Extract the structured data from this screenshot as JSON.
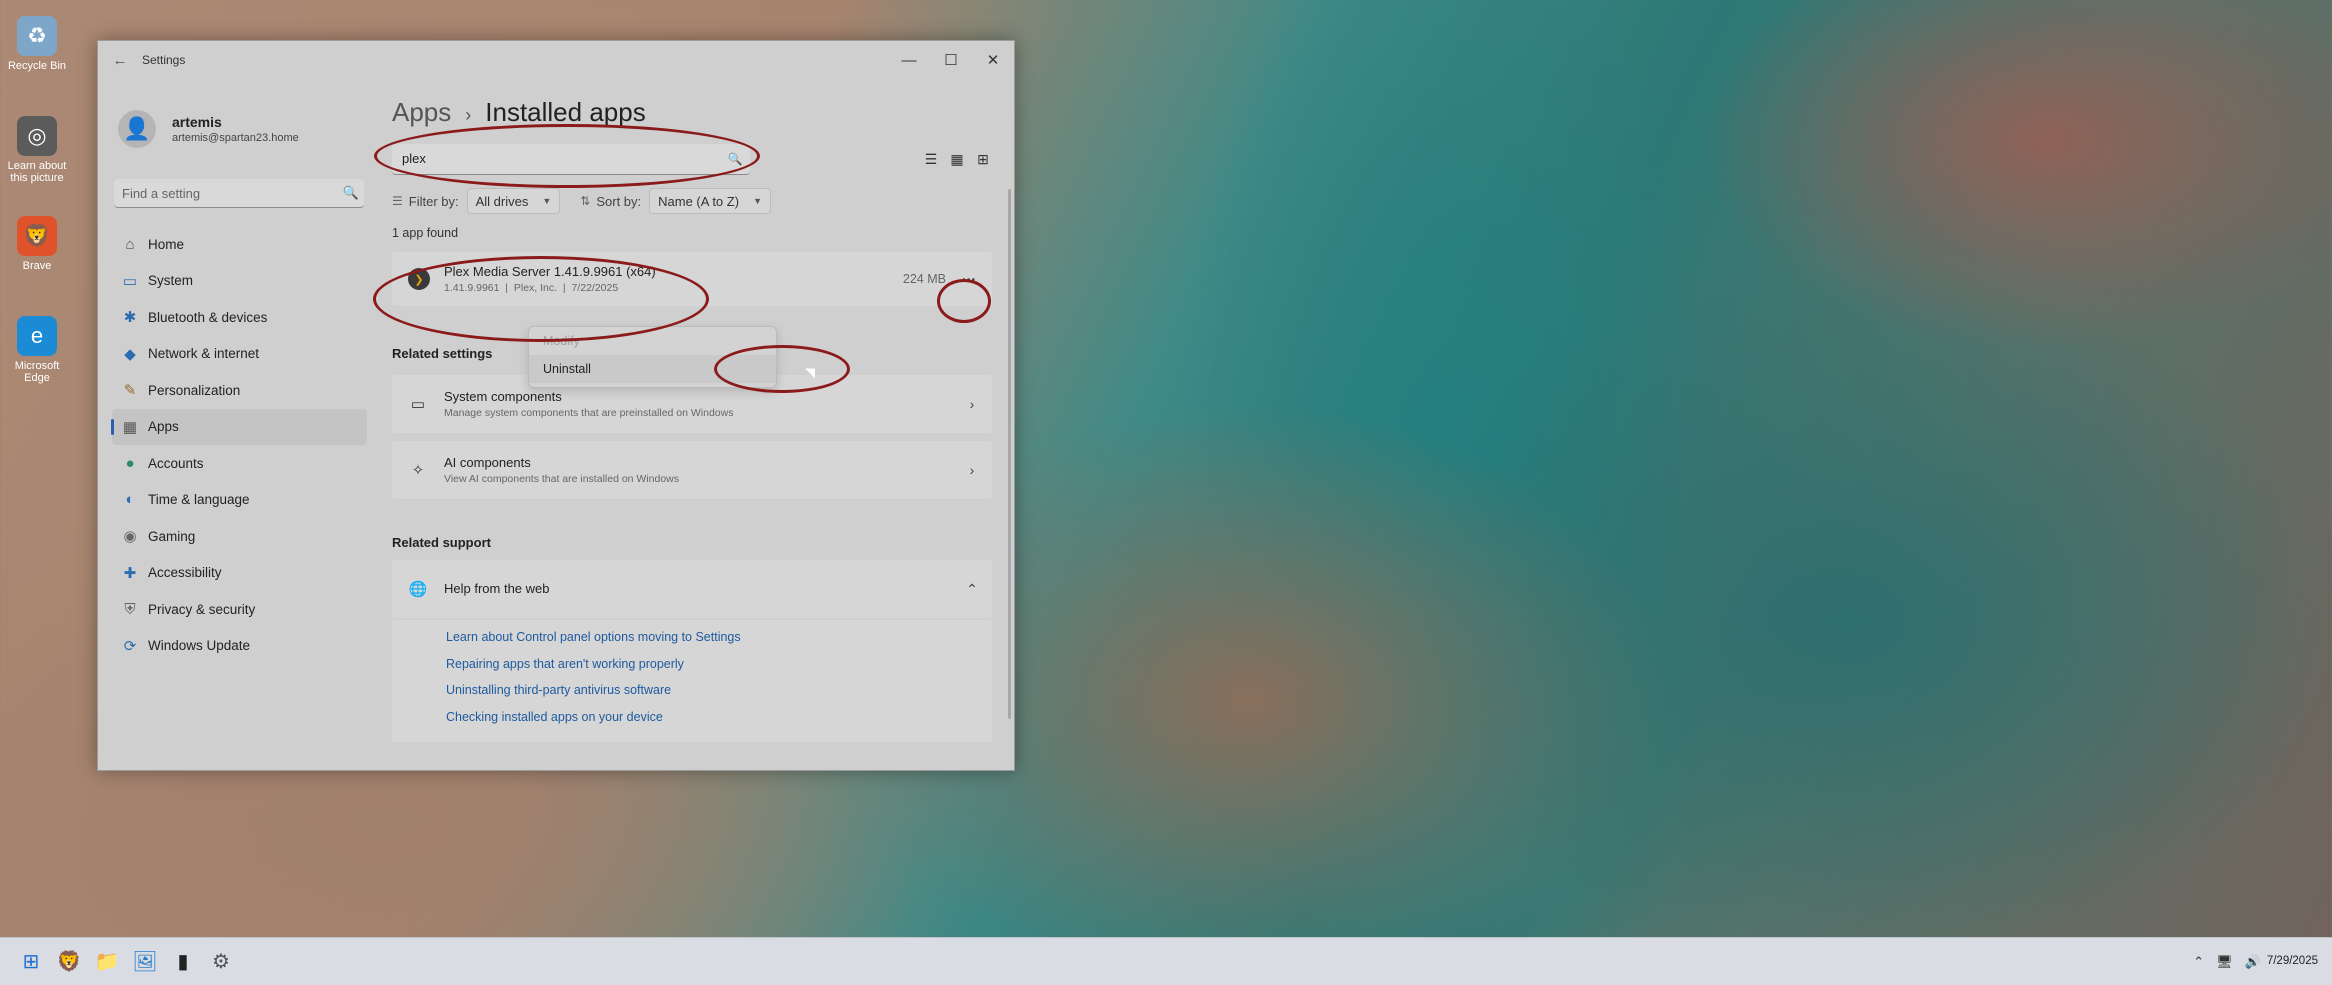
{
  "desktop": {
    "icons": [
      {
        "name": "recycle-bin-icon",
        "label": "Recycle Bin",
        "glyph": "♻",
        "color": "#7da6c9"
      },
      {
        "name": "learn-about-picture-icon",
        "label": "Learn about this picture",
        "glyph": "◎",
        "color": "#5b5b5b"
      },
      {
        "name": "brave-icon",
        "label": "Brave",
        "glyph": "🦁",
        "color": "#e0522a"
      },
      {
        "name": "edge-icon",
        "label": "Microsoft Edge",
        "glyph": "e",
        "color": "#1a8bd4"
      }
    ]
  },
  "window": {
    "title": "Settings",
    "back_glyph": "←",
    "minimize_glyph": "—",
    "maximize_glyph": "☐",
    "close_glyph": "✕"
  },
  "user": {
    "name": "artemis",
    "email": "artemis@spartan23.home"
  },
  "find_setting": {
    "placeholder": "Find a setting",
    "icon": "🔍"
  },
  "nav": [
    {
      "key": "home",
      "label": "Home",
      "icon": "⌂",
      "color": "#555"
    },
    {
      "key": "system",
      "label": "System",
      "icon": "▭",
      "color": "#2b6cb0"
    },
    {
      "key": "bluetooth",
      "label": "Bluetooth & devices",
      "icon": "✱",
      "color": "#2b6cb0"
    },
    {
      "key": "network",
      "label": "Network & internet",
      "icon": "◆",
      "color": "#2b6cb0"
    },
    {
      "key": "personalization",
      "label": "Personalization",
      "icon": "✎",
      "color": "#9b6a2f"
    },
    {
      "key": "apps",
      "label": "Apps",
      "icon": "▦",
      "color": "#555",
      "active": true
    },
    {
      "key": "accounts",
      "label": "Accounts",
      "icon": "●",
      "color": "#2a8a6a"
    },
    {
      "key": "time",
      "label": "Time & language",
      "icon": "◐",
      "color": "#2b6cb0"
    },
    {
      "key": "gaming",
      "label": "Gaming",
      "icon": "◉",
      "color": "#666"
    },
    {
      "key": "accessibility",
      "label": "Accessibility",
      "icon": "✚",
      "color": "#2b6cb0"
    },
    {
      "key": "privacy",
      "label": "Privacy & security",
      "icon": "⛨",
      "color": "#666"
    },
    {
      "key": "update",
      "label": "Windows Update",
      "icon": "⟳",
      "color": "#2b6cb0"
    }
  ],
  "breadcrumb": {
    "root": "Apps",
    "sep": "›",
    "current": "Installed apps"
  },
  "search": {
    "value": "plex",
    "icon": "🔍"
  },
  "view_buttons": [
    "☰",
    "▦",
    "⊞"
  ],
  "filter": {
    "label": "Filter by:",
    "value": "All drives"
  },
  "sort": {
    "label": "Sort by:",
    "value": "Name (A to Z)"
  },
  "found_text": "1 app found",
  "app": {
    "name": "Plex Media Server 1.41.9.9961 (x64)",
    "version": "1.41.9.9961",
    "publisher": "Plex, Inc.",
    "date": "7/22/2025",
    "size": "224 MB",
    "more_glyph": "···"
  },
  "context_menu": {
    "modify": "Modify",
    "uninstall": "Uninstall"
  },
  "related_settings": {
    "heading": "Related settings",
    "items": [
      {
        "title": "System components",
        "subtitle": "Manage system components that are preinstalled on Windows",
        "icon": "▭"
      },
      {
        "title": "AI components",
        "subtitle": "View AI components that are installed on Windows",
        "icon": "✧"
      }
    ]
  },
  "related_support": {
    "heading": "Related support",
    "help_title": "Help from the web",
    "links": [
      "Learn about Control panel options moving to Settings",
      "Repairing apps that aren't working properly",
      "Uninstalling third-party antivirus software",
      "Checking installed apps on your device"
    ]
  },
  "taskbar": {
    "apps": [
      {
        "name": "start-icon",
        "glyph": "⊞",
        "color": "#1f6fd1"
      },
      {
        "name": "brave-taskbar-icon",
        "glyph": "🦁",
        "color": "#e0522a"
      },
      {
        "name": "file-explorer-icon",
        "glyph": "📁",
        "color": "#d9a21b"
      },
      {
        "name": "photos-icon",
        "glyph": "🖼",
        "color": "#2b7ac9"
      },
      {
        "name": "terminal-icon",
        "glyph": "▮",
        "color": "#222"
      },
      {
        "name": "settings-taskbar-icon",
        "glyph": "⚙",
        "color": "#555"
      }
    ],
    "tray_chevron": "⌃",
    "date": "7/29/2025"
  },
  "annotation_color": "#8b1a1a"
}
